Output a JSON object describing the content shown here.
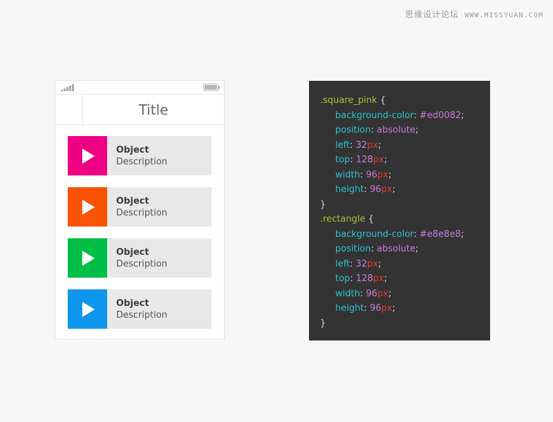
{
  "watermark": {
    "cn": "思缘设计论坛",
    "url": "WWW.MISSYUAN.COM"
  },
  "phone": {
    "statusbar": {
      "signal_icon": "signal-bars-icon",
      "battery_icon": "battery-icon"
    },
    "navbar": {
      "title": "Title",
      "back_label": ""
    },
    "list": [
      {
        "object": "Object",
        "description": "Description",
        "color": "#ed0082",
        "icon": "play-icon"
      },
      {
        "object": "Object",
        "description": "Description",
        "color": "#fb5305",
        "icon": "play-icon"
      },
      {
        "object": "Object",
        "description": "Description",
        "color": "#01be47",
        "icon": "play-icon"
      },
      {
        "object": "Object",
        "description": "Description",
        "color": "#0d96ec",
        "icon": "play-icon"
      }
    ]
  },
  "code": {
    "background": "#333333",
    "rules": [
      {
        "selector": ".square_pink",
        "open": "{",
        "close": "}",
        "declarations": [
          {
            "property": "background-color",
            "value": "#ed0082",
            "unit": "",
            "kind": "color"
          },
          {
            "property": "position",
            "value": "absolute",
            "unit": "",
            "kind": "keyword"
          },
          {
            "property": "left",
            "value": "32",
            "unit": "px",
            "kind": "number"
          },
          {
            "property": "top",
            "value": "128",
            "unit": "px",
            "kind": "number"
          },
          {
            "property": "width",
            "value": "96",
            "unit": "px",
            "kind": "number"
          },
          {
            "property": "height",
            "value": "96",
            "unit": "px",
            "kind": "number"
          }
        ]
      },
      {
        "selector": ".rectangle",
        "open": "{",
        "close": "}",
        "declarations": [
          {
            "property": "background-color",
            "value": "#e8e8e8",
            "unit": "",
            "kind": "color"
          },
          {
            "property": "position",
            "value": "absolute",
            "unit": "",
            "kind": "keyword"
          },
          {
            "property": "left",
            "value": "32",
            "unit": "px",
            "kind": "number"
          },
          {
            "property": "top",
            "value": "128",
            "unit": "px",
            "kind": "number"
          },
          {
            "property": "width",
            "value": "96",
            "unit": "px",
            "kind": "number"
          },
          {
            "property": "height",
            "value": "96",
            "unit": "px",
            "kind": "number"
          }
        ]
      }
    ]
  }
}
